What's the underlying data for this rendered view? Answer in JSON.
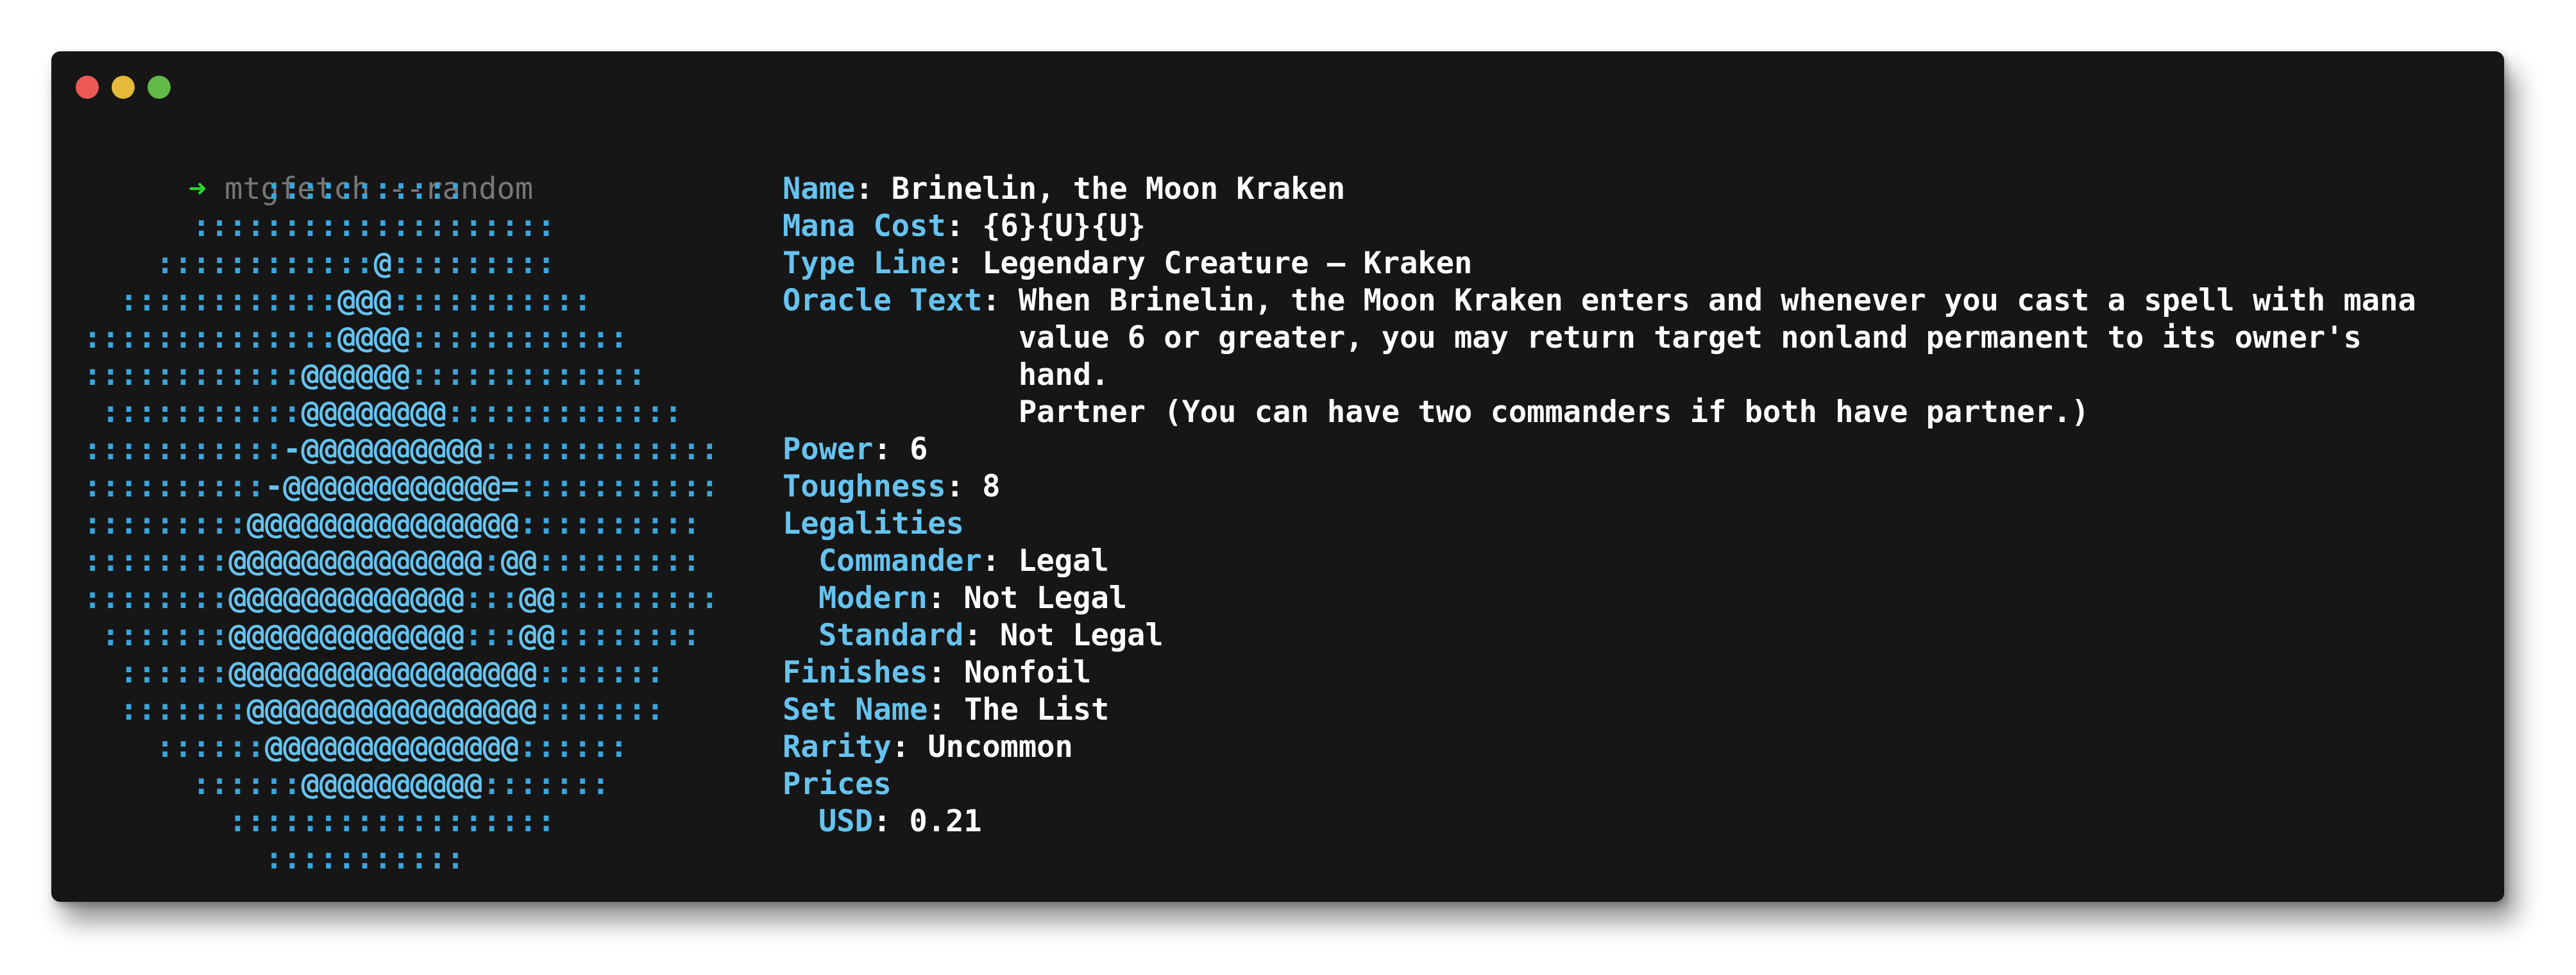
{
  "window": {
    "traffic_lights": [
      {
        "name": "close",
        "color": "#ed5a55"
      },
      {
        "name": "minimize",
        "color": "#e5b93a"
      },
      {
        "name": "maximize",
        "color": "#5fba46"
      }
    ]
  },
  "colors": {
    "background": "#161616",
    "key": "#66c3ef",
    "value": "#ffffff",
    "prompt_arrow": "#2fd42f",
    "command": "#777777",
    "art_dots": "#3aa6dc",
    "art_at": "#66c3ef"
  },
  "prompt": {
    "arrow": "➜",
    "command": "mtgfetch --random"
  },
  "ascii_art": [
    "          :::::::::::",
    "      ::::::::::::::::::::",
    "    ::::::::::::@:::::::::",
    "  ::::::::::::@@@:::::::::::",
    "::::::::::::::@@@@::::::::::::",
    "::::::::::::@@@@@@:::::::::::::",
    " :::::::::::@@@@@@@@:::::::::::::",
    ":::::::::::-@@@@@@@@@@:::::::::::::",
    "::::::::::-@@@@@@@@@@@@=:::::::::::",
    ":::::::::@@@@@@@@@@@@@@@::::::::::",
    "::::::::@@@@@@@@@@@@@@:@@:::::::::",
    "::::::::@@@@@@@@@@@@@:::@@:::::::::",
    " :::::::@@@@@@@@@@@@@:::@@::::::::",
    "  ::::::@@@@@@@@@@@@@@@@@:::::::",
    "  :::::::@@@@@@@@@@@@@@@@:::::::",
    "    ::::::@@@@@@@@@@@@@@::::::",
    "      ::::::@@@@@@@@@@:::::::",
    "        ::::::::::::::::::",
    "          :::::::::::"
  ],
  "card": {
    "name_label": "Name",
    "name": "Brinelin, the Moon Kraken",
    "mana_cost_label": "Mana Cost",
    "mana_cost": "{6}{U}{U}",
    "type_line_label": "Type Line",
    "type_line": "Legendary Creature — Kraken",
    "oracle_text_label": "Oracle Text",
    "oracle_text_lines": [
      "When Brinelin, the Moon Kraken enters and whenever you cast a spell with mana",
      "value 6 or greater, you may return target nonland permanent to its owner's",
      "hand.",
      "Partner (You can have two commanders if both have partner.)"
    ],
    "power_label": "Power",
    "power": "6",
    "toughness_label": "Toughness",
    "toughness": "8",
    "legalities_label": "Legalities",
    "legalities": [
      {
        "format": "Commander",
        "status": "Legal"
      },
      {
        "format": "Modern",
        "status": "Not Legal"
      },
      {
        "format": "Standard",
        "status": "Not Legal"
      }
    ],
    "finishes_label": "Finishes",
    "finishes": "Nonfoil",
    "set_name_label": "Set Name",
    "set_name": "The List",
    "rarity_label": "Rarity",
    "rarity": "Uncommon",
    "prices_label": "Prices",
    "prices": [
      {
        "currency": "USD",
        "amount": "0.21"
      }
    ]
  },
  "separator": ": "
}
